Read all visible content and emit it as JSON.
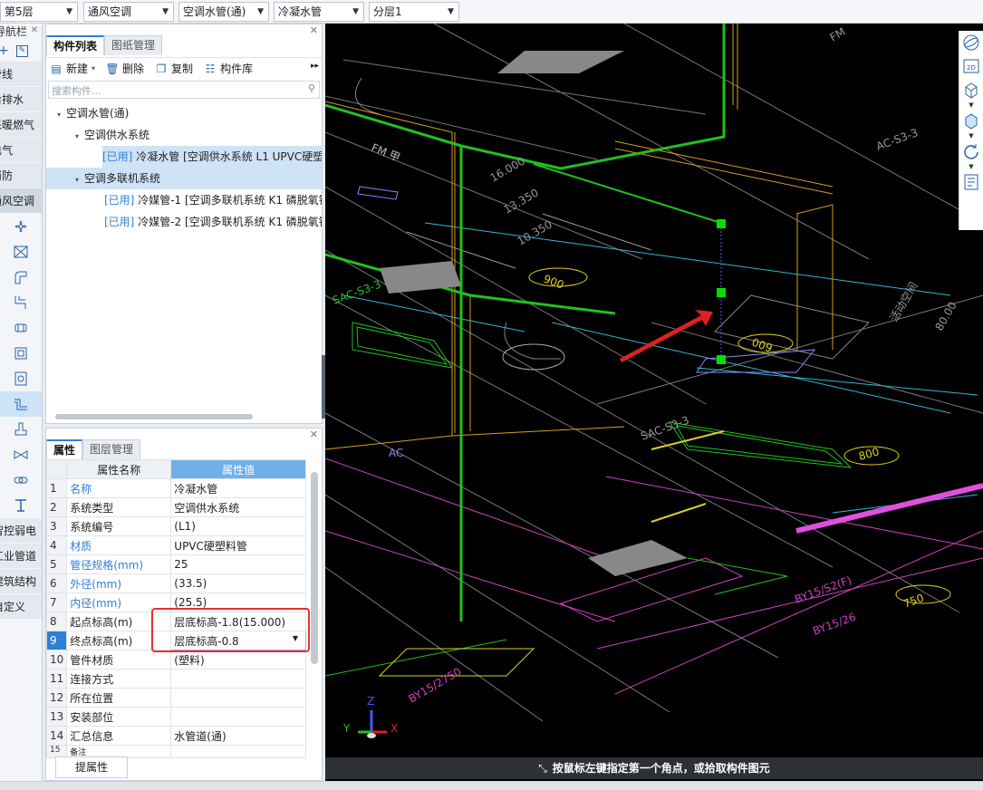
{
  "selectors": {
    "floor": "第5层",
    "discipline": "通风空调",
    "category": "空调水管(通)",
    "type": "冷凝水管",
    "layer": "分层1"
  },
  "leftnav": {
    "title": "导航栏",
    "items": [
      "管线",
      "给排水",
      "采暖燃气",
      "电气",
      "消防",
      "通风空调"
    ],
    "lower_items": [
      "智控弱电",
      "工业管道",
      "建筑结构",
      "自定义"
    ]
  },
  "component_panel": {
    "tabs": [
      "构件列表",
      "图纸管理"
    ],
    "toolbar": [
      "新建",
      "删除",
      "复制",
      "构件库"
    ],
    "search_placeholder": "搜索构件...",
    "tree": [
      {
        "level": 0,
        "label": "空调水管(通)"
      },
      {
        "level": 1,
        "label": "空调供水系统"
      },
      {
        "level": 2,
        "tag": "[已用]",
        "label": "冷凝水管 [空调供水系统 L1 UPVC硬塑",
        "selected": true
      },
      {
        "level": 1,
        "label": "空调多联机系统",
        "selected": true
      },
      {
        "level": 2,
        "tag": "[已用]",
        "label": "冷媒管-1 [空调多联机系统 K1 磷脱氧铜"
      },
      {
        "level": 2,
        "tag": "[已用]",
        "label": "冷媒管-2 [空调多联机系统 K1 磷脱氧铜"
      }
    ]
  },
  "properties_panel": {
    "tabs": [
      "属性",
      "图层管理"
    ],
    "header": {
      "name": "属性名称",
      "value": "属性值"
    },
    "rows": [
      {
        "n": "1",
        "name": "名称",
        "value": "冷凝水管",
        "blue": true
      },
      {
        "n": "2",
        "name": "系统类型",
        "value": "空调供水系统",
        "blue": false
      },
      {
        "n": "3",
        "name": "系统编号",
        "value": "(L1)",
        "blue": false
      },
      {
        "n": "4",
        "name": "材质",
        "value": "UPVC硬塑料管",
        "blue": true
      },
      {
        "n": "5",
        "name": "管径规格(mm)",
        "value": "25",
        "blue": true
      },
      {
        "n": "6",
        "name": "外径(mm)",
        "value": "(33.5)",
        "blue": true
      },
      {
        "n": "7",
        "name": "内径(mm)",
        "value": "(25.5)",
        "blue": true
      },
      {
        "n": "8",
        "name": "起点标高(m)",
        "value": "层底标高-1.8(15.000)",
        "blue": false
      },
      {
        "n": "9",
        "name": "终点标高(m)",
        "value": "层底标高-0.8",
        "blue": false
      },
      {
        "n": "10",
        "name": "管件材质",
        "value": "(塑料)",
        "blue": false
      },
      {
        "n": "11",
        "name": "连接方式",
        "value": "",
        "blue": false
      },
      {
        "n": "12",
        "name": "所在位置",
        "value": "",
        "blue": false
      },
      {
        "n": "13",
        "name": "安装部位",
        "value": "",
        "blue": false
      },
      {
        "n": "14",
        "name": "汇总信息",
        "value": "水管道(通)",
        "blue": false
      },
      {
        "n": "15",
        "name": "备注",
        "value": "",
        "blue": false
      }
    ],
    "button": "提属性"
  },
  "viewport": {
    "status_text": "按鼠标左键指定第一个角点，或拾取构件图元",
    "axis": {
      "x": "X",
      "y": "Y",
      "z": "Z"
    },
    "cad_text": [
      "FM 甲",
      "16.000",
      "13.350",
      "10.350",
      "900",
      "AC",
      "SAC-S3-3",
      "009",
      "800",
      "SAC-S3-3",
      "AC-S3-3",
      "BY15/S2(F)",
      "BY15/26",
      "750",
      "BY15/2750",
      "FM",
      "活动空间",
      "80.00"
    ]
  },
  "icons": {
    "right_tools": [
      "orbit-icon",
      "view-2d-icon",
      "view-3d-box-icon",
      "wireframe-box-icon",
      "rotate-icon",
      "properties-icon"
    ]
  }
}
